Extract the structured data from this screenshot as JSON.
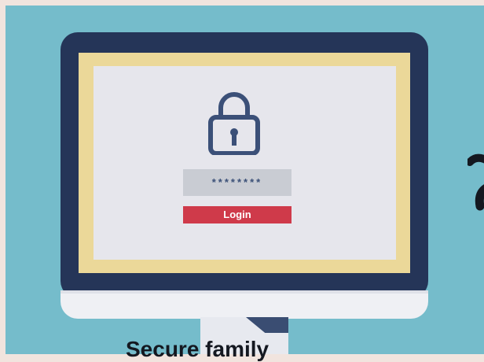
{
  "login": {
    "password_mask": "********",
    "button_label": "Login"
  },
  "bottom_text": "Secure family",
  "icons": {
    "lock": "padlock-icon"
  },
  "colors": {
    "background": "#75bccb",
    "monitor_frame": "#253558",
    "bezel": "#ebd899",
    "screen": "#e6e6ec",
    "login_button": "#cf3a4a",
    "password_field": "#c9ccd3"
  }
}
